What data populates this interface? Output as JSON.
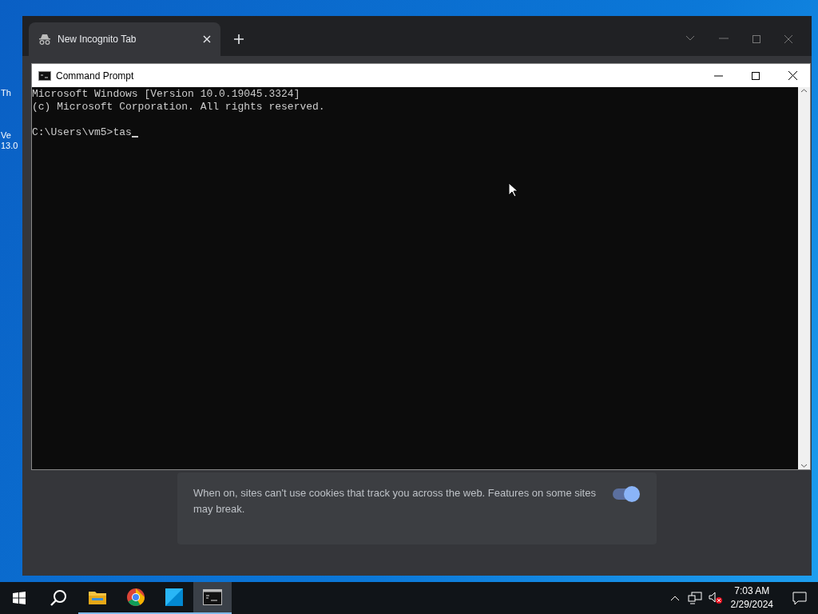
{
  "desktop_icons": [
    {
      "label": "Th"
    },
    {
      "label": "Ve\n13.0"
    }
  ],
  "browser": {
    "tabs": [
      {
        "title": "New Incognito Tab",
        "selected": true
      }
    ],
    "setting_card": {
      "description": "When on, sites can't use cookies that track you across the web. Features on some sites may break.",
      "on": true
    }
  },
  "console": {
    "title": "Command Prompt",
    "lines": [
      "Microsoft Windows [Version 10.0.19045.3324]",
      "(c) Microsoft Corporation. All rights reserved."
    ],
    "prompt": "C:\\Users\\vm5>tas"
  },
  "taskbar": {
    "apps": [
      {
        "kind": "explorer",
        "active": false
      },
      {
        "kind": "chrome",
        "active": false
      },
      {
        "kind": "app",
        "active": false
      },
      {
        "kind": "console",
        "active": true
      }
    ],
    "time": "7:03 AM",
    "date": "2/29/2024"
  }
}
